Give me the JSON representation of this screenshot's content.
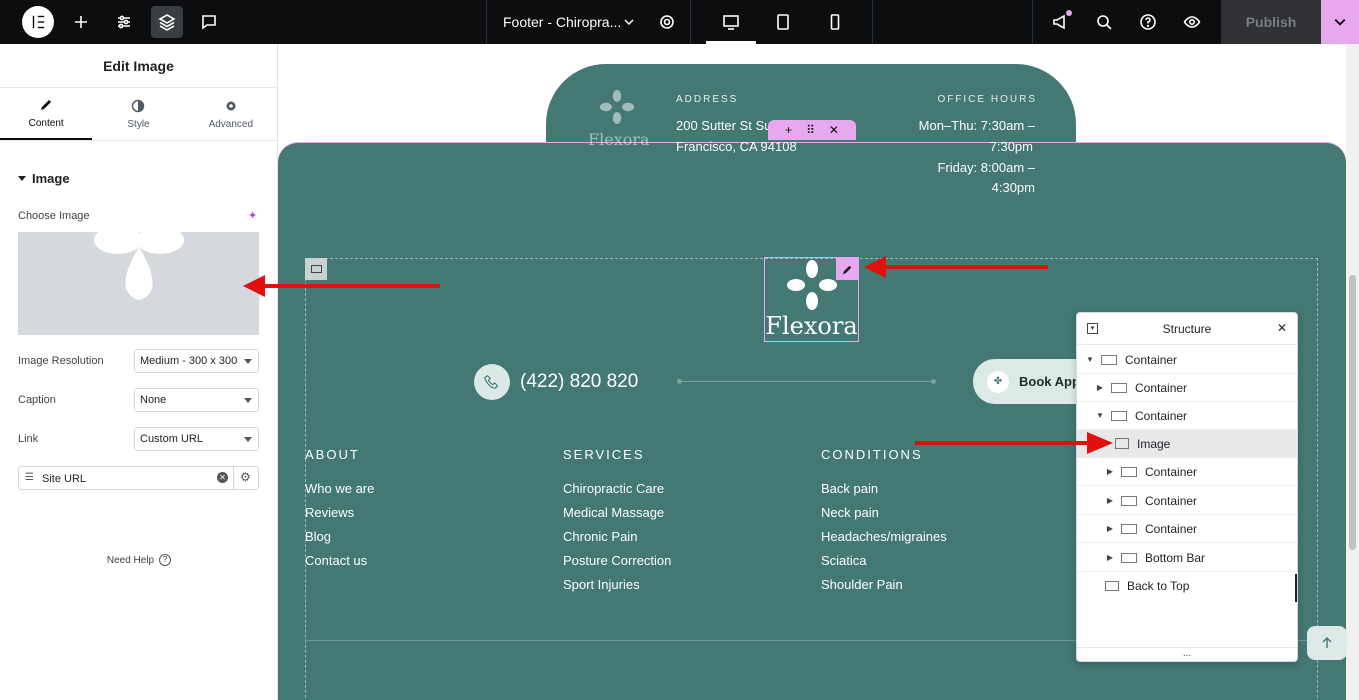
{
  "topbar": {
    "document_title": "Footer - Chiropra...",
    "publish_label": "Publish"
  },
  "panel": {
    "title": "Edit Image",
    "tabs": [
      {
        "label": "Content"
      },
      {
        "label": "Style"
      },
      {
        "label": "Advanced"
      }
    ],
    "section_title": "Image",
    "choose_image_label": "Choose Image",
    "resolution_label": "Image Resolution",
    "resolution_value": "Medium - 300 x 300",
    "caption_label": "Caption",
    "caption_value": "None",
    "link_label": "Link",
    "link_value": "Custom URL",
    "site_url_value": "Site URL",
    "need_help": "Need Help"
  },
  "canvas": {
    "logo_text": "Flexora",
    "address_heading": "ADDRESS",
    "address_line1": "200 Sutter St Sui",
    "address_line2": "Francisco, CA 94108",
    "hours_heading": "OFFICE HOURS",
    "hours_line1": "Mon–Thu: 7:30am –",
    "hours_line2": "7:30pm",
    "hours_line3": "Friday: 8:00am –",
    "hours_line4": "4:30pm",
    "phone": "(422) 820 820",
    "book_button": "Book App",
    "columns": [
      {
        "heading": "ABOUT",
        "links": [
          "Who we are",
          "Reviews",
          "Blog",
          "Contact us"
        ]
      },
      {
        "heading": "SERVICES",
        "links": [
          "Chiropractic Care",
          "Medical Massage",
          "Chronic Pain",
          "Posture Correction",
          "Sport Injuries"
        ]
      },
      {
        "heading": "CONDITIONS",
        "links": [
          "Back pain",
          "Neck pain",
          "Headaches/migraines",
          "Sciatica",
          "Shoulder Pain"
        ]
      }
    ]
  },
  "structure": {
    "title": "Structure",
    "items": [
      {
        "label": "Container"
      },
      {
        "label": "Container"
      },
      {
        "label": "Container"
      },
      {
        "label": "Image"
      },
      {
        "label": "Container"
      },
      {
        "label": "Container"
      },
      {
        "label": "Container"
      },
      {
        "label": "Bottom Bar"
      },
      {
        "label": "Back to Top"
      }
    ],
    "more": "..."
  },
  "colors": {
    "footer_teal": "#437873",
    "accent_pink": "#e7a8f0",
    "annotation_red": "#e0100f"
  }
}
